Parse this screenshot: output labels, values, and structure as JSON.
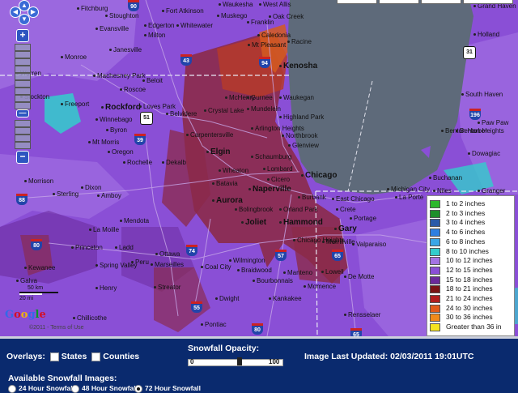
{
  "map": {
    "cities": [
      {
        "name": "Fitchburg",
        "big": false
      },
      {
        "name": "Stoughton",
        "big": false
      },
      {
        "name": "Fort Atkinson",
        "big": false
      },
      {
        "name": "Waukesha",
        "big": false
      },
      {
        "name": "West Allis",
        "big": false
      },
      {
        "name": "Muskego",
        "big": false
      },
      {
        "name": "Oak Creek",
        "big": false
      },
      {
        "name": "Franklin",
        "big": false
      },
      {
        "name": "Evansville",
        "big": false
      },
      {
        "name": "Edgerton",
        "big": false
      },
      {
        "name": "Whitewater",
        "big": false
      },
      {
        "name": "Milton",
        "big": false
      },
      {
        "name": "Caledonia",
        "big": false
      },
      {
        "name": "Mt Pleasant",
        "big": false
      },
      {
        "name": "Racine",
        "big": false
      },
      {
        "name": "Monroe",
        "big": false
      },
      {
        "name": "Janesville",
        "big": false
      },
      {
        "name": "Kenosha",
        "big": true
      },
      {
        "name": "Beloit",
        "big": false
      },
      {
        "name": "Roscoe",
        "big": false
      },
      {
        "name": "Warren",
        "big": false
      },
      {
        "name": "Machesney Park",
        "big": false
      },
      {
        "name": "McHenry",
        "big": false
      },
      {
        "name": "Gurnee",
        "big": false
      },
      {
        "name": "Waukegan",
        "big": false
      },
      {
        "name": "Stockton",
        "big": false
      },
      {
        "name": "Freeport",
        "big": false
      },
      {
        "name": "Rockford",
        "big": true
      },
      {
        "name": "Loves Park",
        "big": false
      },
      {
        "name": "Crystal Lake",
        "big": false
      },
      {
        "name": "Mundelein",
        "big": false
      },
      {
        "name": "Winnebago",
        "big": false
      },
      {
        "name": "Belvidere",
        "big": false
      },
      {
        "name": "Highland Park",
        "big": false
      },
      {
        "name": "Arlington Heights",
        "big": false
      },
      {
        "name": "Northbrook",
        "big": false
      },
      {
        "name": "Byron",
        "big": false
      },
      {
        "name": "Carpentersville",
        "big": false
      },
      {
        "name": "Elgin",
        "big": true
      },
      {
        "name": "Glenview",
        "big": false
      },
      {
        "name": "Mt Morris",
        "big": false
      },
      {
        "name": "Oregon",
        "big": false
      },
      {
        "name": "Schaumburg",
        "big": false
      },
      {
        "name": "Rochelle",
        "big": false
      },
      {
        "name": "Dekalb",
        "big": false
      },
      {
        "name": "Wheaton",
        "big": false
      },
      {
        "name": "Lombard",
        "big": false
      },
      {
        "name": "Batavia",
        "big": false
      },
      {
        "name": "Cicero",
        "big": false
      },
      {
        "name": "Chicago",
        "big": true
      },
      {
        "name": "Dixon",
        "big": false
      },
      {
        "name": "Morrison",
        "big": false
      },
      {
        "name": "Sterling",
        "big": false
      },
      {
        "name": "Amboy",
        "big": false
      },
      {
        "name": "Naperville",
        "big": true
      },
      {
        "name": "Aurora",
        "big": true
      },
      {
        "name": "Bolingbrook",
        "big": false
      },
      {
        "name": "Burbank",
        "big": false
      },
      {
        "name": "Orland Park",
        "big": false
      },
      {
        "name": "East Chicago",
        "big": false
      },
      {
        "name": "Joliet",
        "big": true
      },
      {
        "name": "Hammond",
        "big": true
      },
      {
        "name": "Gary",
        "big": true
      },
      {
        "name": "Portage",
        "big": false
      },
      {
        "name": "Mendota",
        "big": false
      },
      {
        "name": "La Moille",
        "big": false
      },
      {
        "name": "Princeton",
        "big": false
      },
      {
        "name": "Ladd",
        "big": false
      },
      {
        "name": "Ottawa",
        "big": false
      },
      {
        "name": "Marseilles",
        "big": false
      },
      {
        "name": "Wilmington",
        "big": false
      },
      {
        "name": "Peru",
        "big": false
      },
      {
        "name": "Spring Valley",
        "big": false
      },
      {
        "name": "Coal City",
        "big": false
      },
      {
        "name": "Braidwood",
        "big": false
      },
      {
        "name": "Chicago Heights",
        "big": false
      },
      {
        "name": "Merrillville",
        "big": false
      },
      {
        "name": "Valparaiso",
        "big": false
      },
      {
        "name": "Kewanee",
        "big": false
      },
      {
        "name": "Galva",
        "big": false
      },
      {
        "name": "Henry",
        "big": false
      },
      {
        "name": "Streator",
        "big": false
      },
      {
        "name": "Momence",
        "big": false
      },
      {
        "name": "Lowell",
        "big": false
      },
      {
        "name": "De Motte",
        "big": false
      },
      {
        "name": "Bourbonnais",
        "big": false
      },
      {
        "name": "Manteno",
        "big": false
      },
      {
        "name": "Kankakee",
        "big": false
      },
      {
        "name": "Dwight",
        "big": false
      },
      {
        "name": "Chillicothe",
        "big": false
      },
      {
        "name": "Pontiac",
        "big": false
      },
      {
        "name": "Rensselaer",
        "big": false
      },
      {
        "name": "Holland",
        "big": false
      },
      {
        "name": "Grand Haven",
        "big": false
      },
      {
        "name": "South Haven",
        "big": false
      },
      {
        "name": "Benton Harbor",
        "big": false
      },
      {
        "name": "Benton Heights",
        "big": false
      },
      {
        "name": "Paw Paw",
        "big": false
      },
      {
        "name": "Dowagiac",
        "big": false
      },
      {
        "name": "Buchanan",
        "big": false
      },
      {
        "name": "Niles",
        "big": false
      },
      {
        "name": "Michigan City",
        "big": false
      },
      {
        "name": "La Porte",
        "big": false
      },
      {
        "name": "Granger",
        "big": false
      },
      {
        "name": "Crete",
        "big": false
      }
    ],
    "shields": [
      {
        "num": "90",
        "type": "interstate"
      },
      {
        "num": "43",
        "type": "interstate"
      },
      {
        "num": "94",
        "type": "interstate"
      },
      {
        "num": "51",
        "type": "us"
      },
      {
        "num": "39",
        "type": "interstate"
      },
      {
        "num": "88",
        "type": "interstate"
      },
      {
        "num": "80",
        "type": "interstate"
      },
      {
        "num": "55",
        "type": "interstate"
      },
      {
        "num": "57",
        "type": "interstate"
      },
      {
        "num": "65",
        "type": "interstate"
      },
      {
        "num": "74",
        "type": "interstate"
      },
      {
        "num": "31",
        "type": "us"
      },
      {
        "num": "196",
        "type": "interstate"
      },
      {
        "num": "65",
        "type": "interstate"
      },
      {
        "num": "80",
        "type": "interstate"
      }
    ],
    "scale": {
      "km": "50 km",
      "mi": "20 mi"
    },
    "logo": "Google",
    "copyright": "©2011 - Terms of Use"
  },
  "legend": {
    "items": [
      {
        "label": "1 to 2 inches",
        "color": "#2db82d"
      },
      {
        "label": "2 to 3 inches",
        "color": "#1f8f2a"
      },
      {
        "label": "3 to 4 inches",
        "color": "#2a5aa8"
      },
      {
        "label": "4 to 6 inches",
        "color": "#2f7fe0"
      },
      {
        "label": "6 to 8 inches",
        "color": "#3ba6e6"
      },
      {
        "label": "8 to 10 inches",
        "color": "#33cccc"
      },
      {
        "label": "10 to 12 inches",
        "color": "#a373e3"
      },
      {
        "label": "12 to 15 inches",
        "color": "#8a4fd6"
      },
      {
        "label": "15 to 18 inches",
        "color": "#6a2a9a"
      },
      {
        "label": "18 to 21 inches",
        "color": "#7a1414"
      },
      {
        "label": "21 to 24 inches",
        "color": "#b01e1e"
      },
      {
        "label": "24 to 30 inches",
        "color": "#e05a1a"
      },
      {
        "label": "30 to 36 inches",
        "color": "#f08a1a"
      },
      {
        "label": "Greater than 36 in",
        "color": "#f5e31f"
      }
    ]
  },
  "panel": {
    "overlays_label": "Overlays:",
    "states_label": "States",
    "counties_label": "Counties",
    "opacity_label": "Snowfall Opacity:",
    "opacity_min": "0",
    "opacity_max": "100",
    "opacity_value": 0.55,
    "updated_label": "Image Last Updated: 02/03/2011 19:01UTC",
    "available_label": "Available Snowfall Images:",
    "options": [
      {
        "label": "24 Hour Snowfall",
        "selected": false
      },
      {
        "label": "48 Hour Snowfall",
        "selected": false
      },
      {
        "label": "72 Hour Snowfall",
        "selected": true
      }
    ]
  }
}
